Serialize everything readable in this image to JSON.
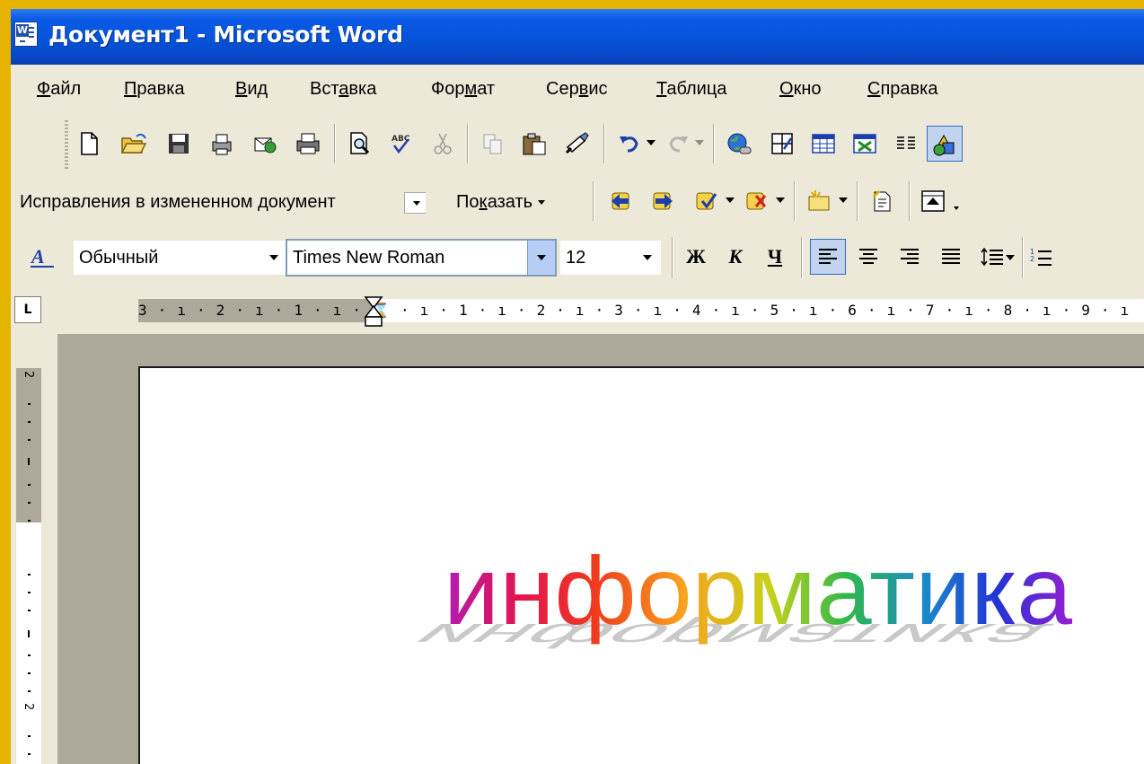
{
  "window": {
    "title": "Документ1 - Microsoft Word",
    "app_icon": "W"
  },
  "menu": [
    {
      "label": "Файл",
      "underline": "Ф",
      "rest": "айл"
    },
    {
      "label": "Правка",
      "underline": "П",
      "rest": "равка"
    },
    {
      "label": "Вид",
      "underline": "В",
      "rest": "ид"
    },
    {
      "label": "Вставка",
      "pre": "Вст",
      "underline": "а",
      "rest": "вка"
    },
    {
      "label": "Формат",
      "pre": "Фор",
      "underline": "м",
      "rest": "ат"
    },
    {
      "label": "Сервис",
      "pre": "Сер",
      "underline": "в",
      "rest": "ис"
    },
    {
      "label": "Таблица",
      "underline": "Т",
      "rest": "аблица"
    },
    {
      "label": "Окно",
      "underline": "О",
      "rest": "кно"
    },
    {
      "label": "Справка",
      "underline": "С",
      "rest": "правка"
    }
  ],
  "reviewing": {
    "display_combo": "Исправления в измененном документ",
    "show_pre": "По",
    "show_underline": "к",
    "show_rest": "азать"
  },
  "formatting": {
    "style": "Обычный",
    "font": "Times New Roman",
    "size": "12",
    "bold": "Ж",
    "italic": "К",
    "underline": "Ч"
  },
  "ruler": {
    "numbers": "3 · ı · 2 · ı · 1 · ı · ⌛ · ı · 1 · ı · 2 · ı · 3 · ı · 4 · ı · 5 · ı · 6 · ı · 7 · ı · 8 · ı · 9 · ı"
  },
  "document": {
    "wordart_text": "информатика"
  },
  "colors": {
    "title_bar": "#0553d9",
    "frame": "#e6b400",
    "chrome": "#ece9d8"
  }
}
